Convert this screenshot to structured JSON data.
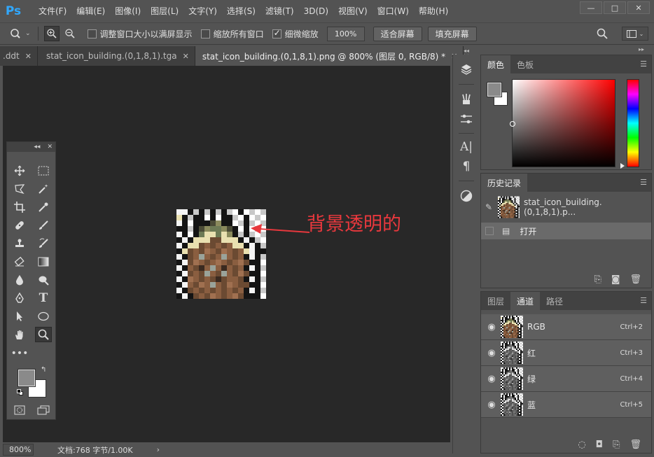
{
  "app": {
    "logo": "Ps",
    "menu": [
      "文件(F)",
      "编辑(E)",
      "图像(I)",
      "图层(L)",
      "文字(Y)",
      "选择(S)",
      "滤镜(T)",
      "3D(D)",
      "视图(V)",
      "窗口(W)",
      "帮助(H)"
    ],
    "window_buttons": [
      "—",
      "□",
      "✕"
    ]
  },
  "options": {
    "resize_windows_label": "调整窗口大小以满屏显示",
    "resize_windows_checked": false,
    "zoom_all_windows_label": "缩放所有窗口",
    "zoom_all_windows_checked": false,
    "scrubby_zoom_label": "细微缩放",
    "scrubby_zoom_checked": true,
    "zoom_value": "100%",
    "fit_screen_label": "适合屏幕",
    "fill_screen_label": "填充屏幕"
  },
  "tabs": [
    {
      "label": ".ddt",
      "close": "✕",
      "active": false
    },
    {
      "label": "stat_icon_building.(0,1,8,1).tga",
      "close": "✕",
      "active": false
    },
    {
      "label": "stat_icon_building.(0,1,8,1).png @ 800% (图层 0, RGB/8) *",
      "close": "✕",
      "active": true
    }
  ],
  "tabs_overflow": "››",
  "annotation": {
    "text": "背景透明的",
    "color": "#e8383d"
  },
  "status": {
    "zoom": "800%",
    "doc_info": "文档:768 字节/1.00K",
    "arrow": "›"
  },
  "color_panel": {
    "tabs": [
      "颜色",
      "色板"
    ],
    "foreground": "#8a8a8a",
    "background": "#ffffff",
    "hue": "#ff0000"
  },
  "history_panel": {
    "title": "历史记录",
    "snapshot_label": "stat_icon_building.(0,1,8,1).p...",
    "steps": [
      "打开"
    ]
  },
  "channels_panel": {
    "tabs": [
      "图层",
      "通道",
      "路径"
    ],
    "channels": [
      {
        "name": "RGB",
        "shortcut": "Ctrl+2"
      },
      {
        "name": "红",
        "shortcut": "Ctrl+3"
      },
      {
        "name": "绿",
        "shortcut": "Ctrl+4"
      },
      {
        "name": "蓝",
        "shortcut": "Ctrl+5"
      }
    ]
  }
}
